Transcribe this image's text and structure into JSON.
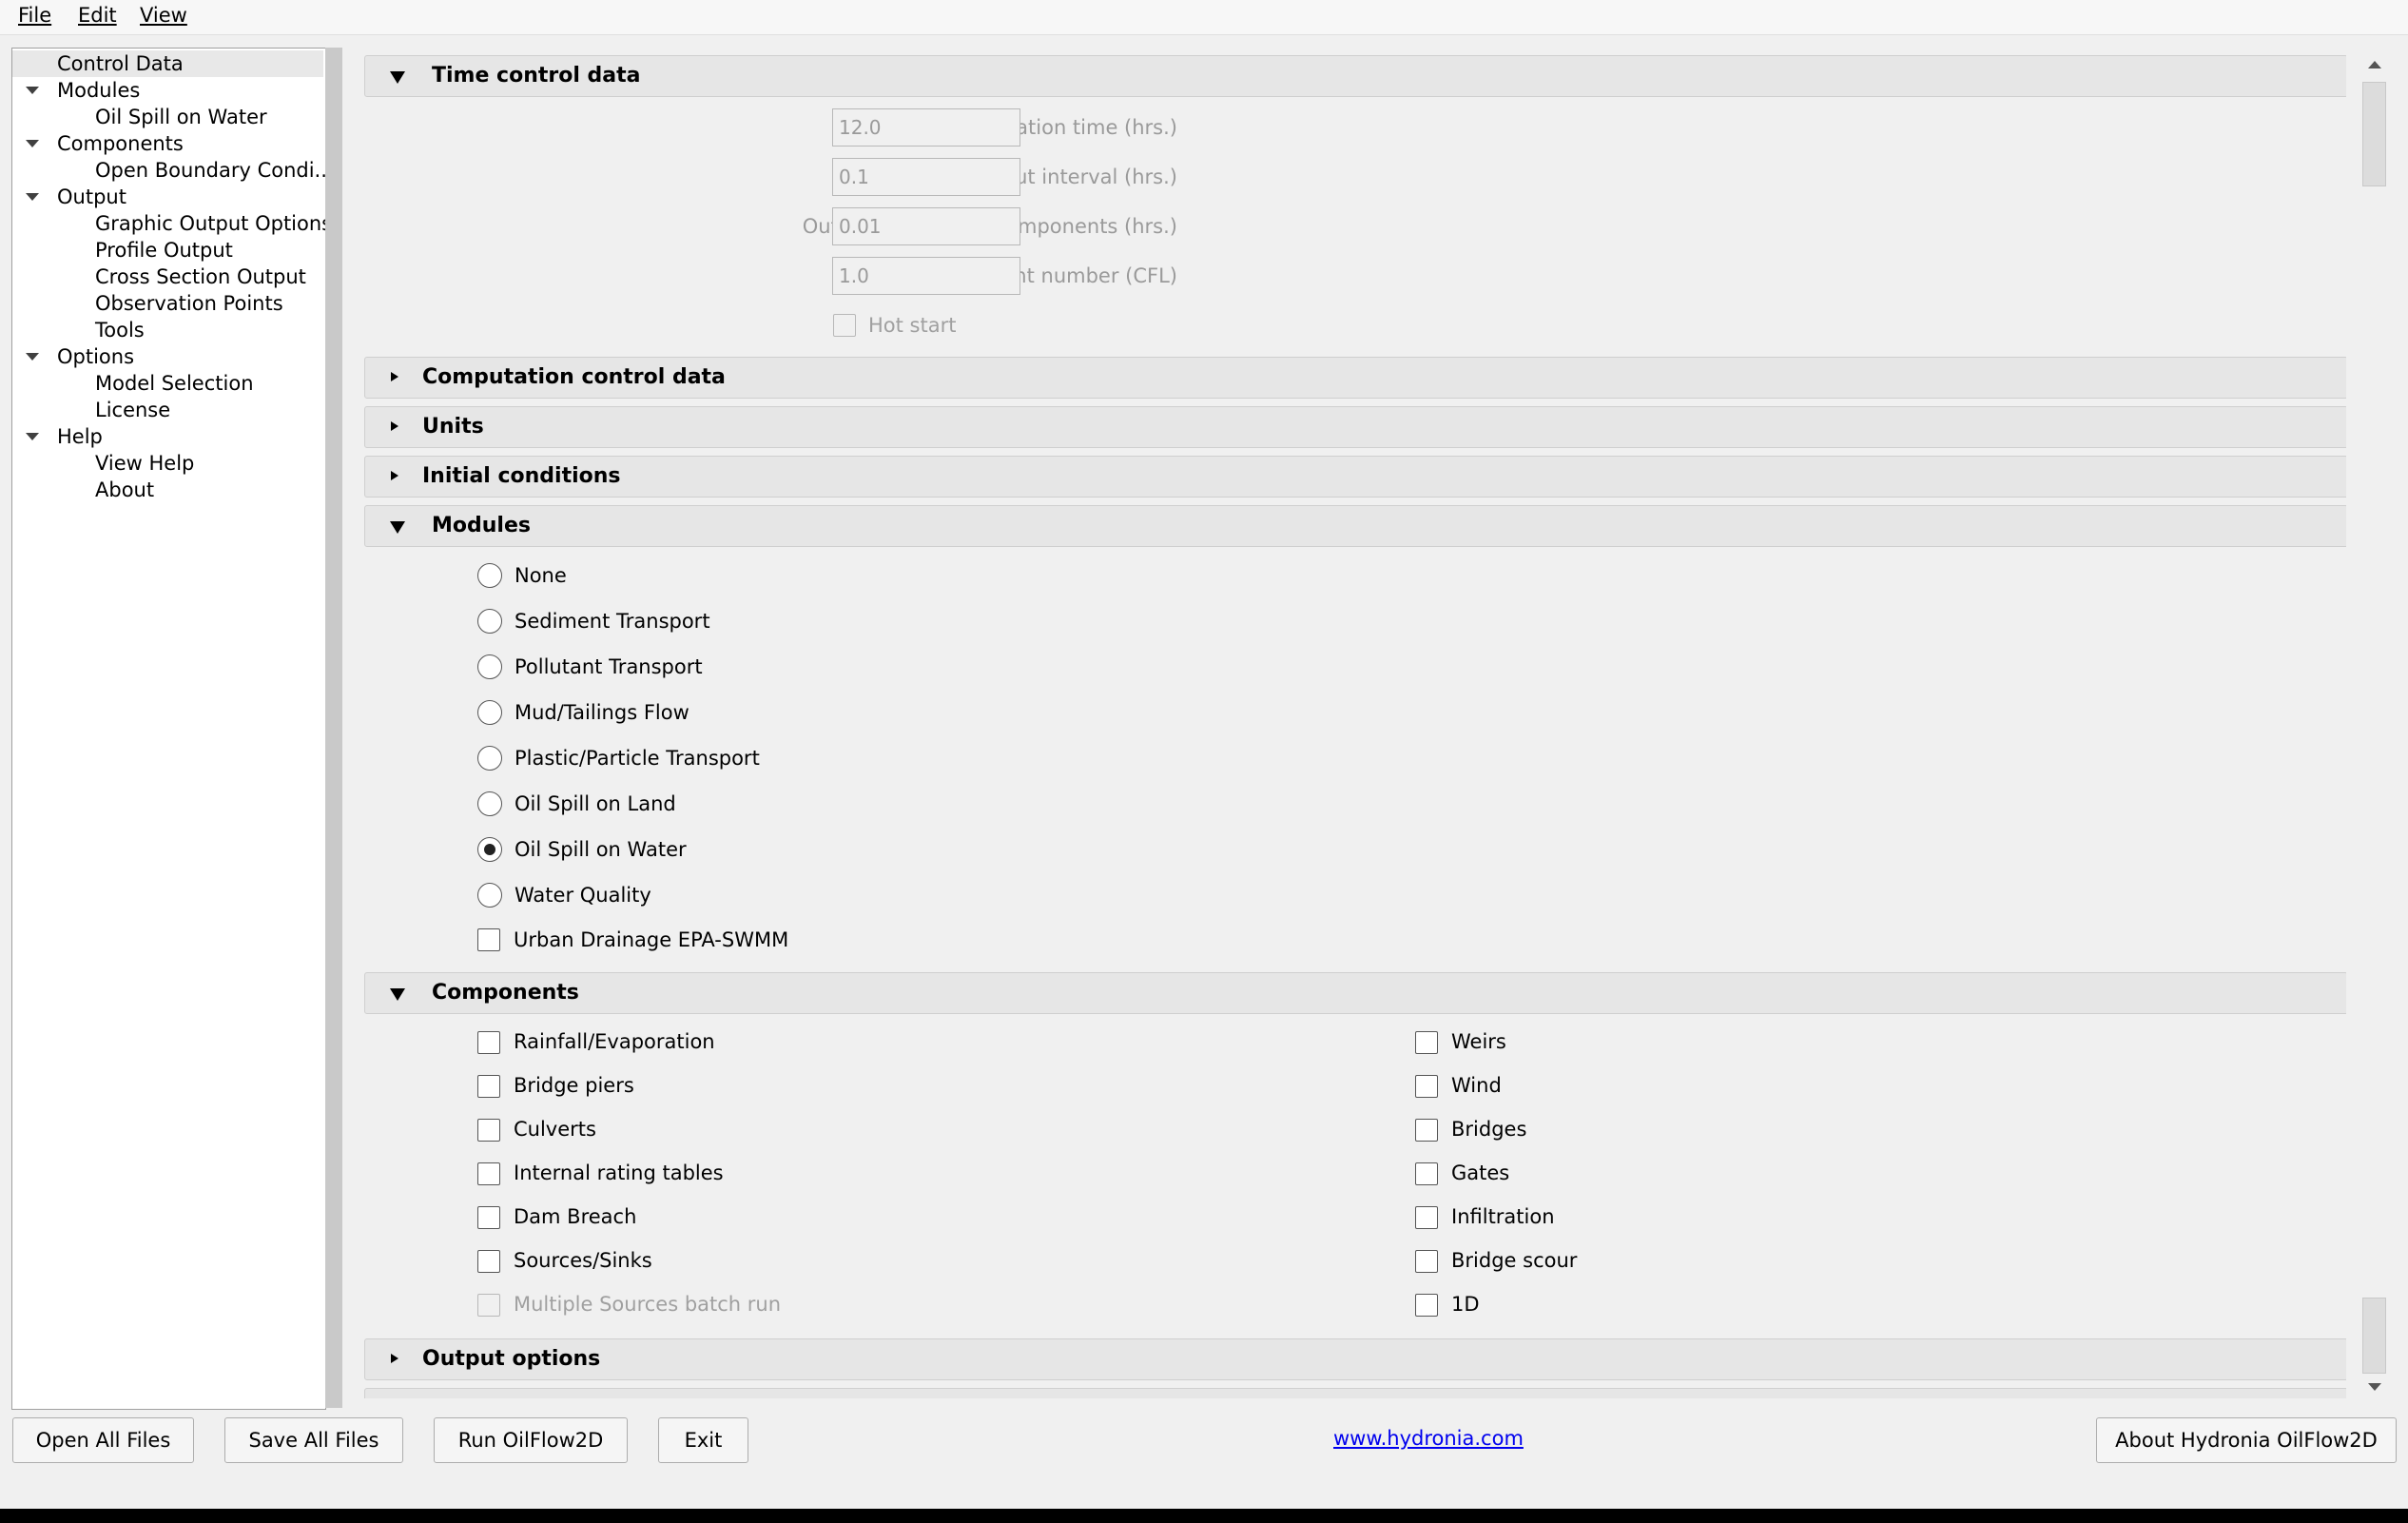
{
  "menu": [
    "File",
    "Edit",
    "View"
  ],
  "tree": [
    {
      "label": "Control Data",
      "level": 0,
      "expander": false,
      "selected": true
    },
    {
      "label": "Modules",
      "level": 0,
      "expander": true
    },
    {
      "label": "Oil Spill on Water",
      "level": 1
    },
    {
      "label": "Components",
      "level": 0,
      "expander": true
    },
    {
      "label": "Open Boundary Condi...",
      "level": 1
    },
    {
      "label": "Output",
      "level": 0,
      "expander": true
    },
    {
      "label": "Graphic Output Options",
      "level": 1
    },
    {
      "label": "Profile Output",
      "level": 1
    },
    {
      "label": "Cross Section Output",
      "level": 1
    },
    {
      "label": "Observation Points",
      "level": 1
    },
    {
      "label": "Tools",
      "level": 1
    },
    {
      "label": "Options",
      "level": 0,
      "expander": true
    },
    {
      "label": "Model Selection",
      "level": 1
    },
    {
      "label": "License",
      "level": 1
    },
    {
      "label": "Help",
      "level": 0,
      "expander": true
    },
    {
      "label": "View Help",
      "level": 1
    },
    {
      "label": "About",
      "level": 1
    }
  ],
  "sections": {
    "time_control": "Time control data",
    "computation": "Computation control data",
    "units": "Units",
    "initial": "Initial conditions",
    "modules": "Modules",
    "components": "Components",
    "output": "Output options"
  },
  "time_fields": [
    {
      "label": "Simulation time (hrs.)",
      "value": "12.0"
    },
    {
      "label": "Output interval (hrs.)",
      "value": "0.1"
    },
    {
      "label": "Output interval for components (hrs.)",
      "value": "0.01"
    },
    {
      "label": "Courant number (CFL)",
      "value": "1.0"
    }
  ],
  "hot_start": "Hot start",
  "modules": [
    {
      "label": "None",
      "selected": false
    },
    {
      "label": "Sediment Transport",
      "selected": false
    },
    {
      "label": "Pollutant Transport",
      "selected": false
    },
    {
      "label": "Mud/Tailings Flow",
      "selected": false
    },
    {
      "label": "Plastic/Particle Transport",
      "selected": false
    },
    {
      "label": "Oil Spill on Land",
      "selected": false
    },
    {
      "label": "Oil Spill on Water",
      "selected": true
    },
    {
      "label": "Water Quality",
      "selected": false
    }
  ],
  "urban_drainage": "Urban Drainage EPA-SWMM",
  "components_left": [
    {
      "label": "Rainfall/Evaporation",
      "disabled": false
    },
    {
      "label": "Bridge piers",
      "disabled": false
    },
    {
      "label": "Culverts",
      "disabled": false
    },
    {
      "label": "Internal rating tables",
      "disabled": false
    },
    {
      "label": "Dam Breach",
      "disabled": false
    },
    {
      "label": "Sources/Sinks",
      "disabled": false
    },
    {
      "label": "Multiple Sources batch run",
      "disabled": true
    }
  ],
  "components_right": [
    {
      "label": "Weirs"
    },
    {
      "label": "Wind"
    },
    {
      "label": "Bridges"
    },
    {
      "label": "Gates"
    },
    {
      "label": "Infiltration"
    },
    {
      "label": "Bridge scour"
    },
    {
      "label": "1D"
    }
  ],
  "buttons": {
    "open_all": "Open All Files",
    "save_all": "Save All Files",
    "run": "Run OilFlow2D",
    "exit": "Exit",
    "about": "About Hydronia OilFlow2D"
  },
  "website": "www.hydronia.com"
}
